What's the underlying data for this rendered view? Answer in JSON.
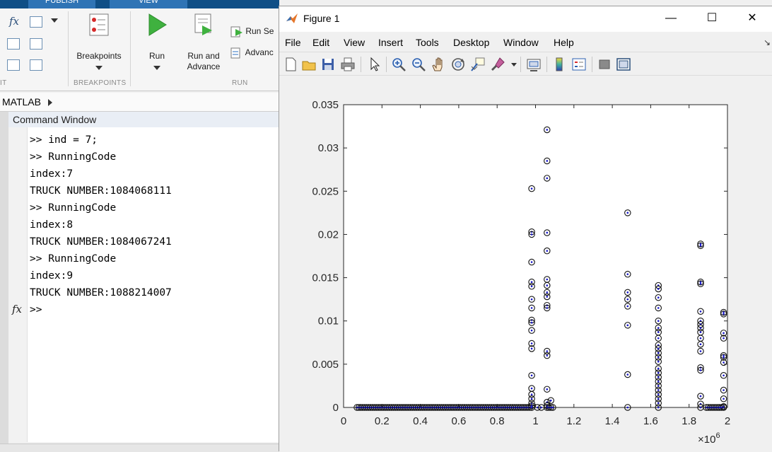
{
  "toolstrip": {
    "tabs": [
      "PUBLISH",
      "VIEW"
    ],
    "breakpoints_label": "Breakpoints",
    "run_label": "Run",
    "run_and_advance_label": "Run and\nAdvance",
    "run_section_label": "Run Se",
    "advance_label": "Advanc",
    "section_breakpoints": "BREAKPOINTS",
    "section_run": "RUN",
    "section_left": "IT"
  },
  "address_bar": {
    "path": "MATLAB"
  },
  "command_window": {
    "title": "Command Window",
    "lines": [
      ">> ind = 7;",
      ">> RunningCode",
      "index:7",
      "TRUCK NUMBER:1084068111",
      ">> RunningCode",
      "index:8",
      "TRUCK NUMBER:1084067241",
      ">> RunningCode",
      "index:9",
      "TRUCK NUMBER:1088214007"
    ],
    "prompt": ">>",
    "fx_symbol": "fx"
  },
  "figure": {
    "title": "Figure 1",
    "window_controls": {
      "minimize": "—",
      "maximize": "☐",
      "close": "✕"
    },
    "menus": [
      "File",
      "Edit",
      "View",
      "Insert",
      "Tools",
      "Desktop",
      "Window",
      "Help"
    ],
    "toolbar_icons": [
      "new-figure-icon",
      "open-file-icon",
      "save-icon",
      "print-icon",
      "select-arrow-icon",
      "zoom-in-icon",
      "zoom-out-icon",
      "pan-hand-icon",
      "rotate-3d-icon",
      "data-cursor-icon",
      "brush-icon",
      "link-plot-icon",
      "colorbar-icon",
      "legend-icon",
      "hide-plot-tools-icon",
      "show-plot-tools-icon"
    ],
    "accent_marker_color": "#1515c8"
  },
  "chart_data": {
    "type": "scatter",
    "title": "",
    "xlabel": "",
    "ylabel": "",
    "x_exponent_label": "×10",
    "x_exponent_power": "6",
    "xlim": [
      0,
      2
    ],
    "ylim": [
      0,
      0.035
    ],
    "x_ticks": [
      "0",
      "0.2",
      "0.4",
      "0.6",
      "0.8",
      "1",
      "1.2",
      "1.4",
      "1.6",
      "1.8",
      "2"
    ],
    "y_ticks": [
      "0",
      "0.005",
      "0.01",
      "0.015",
      "0.02",
      "0.025",
      "0.03",
      "0.035"
    ],
    "grid": false,
    "marker": "circle-dot",
    "points": [
      [
        0.07,
        0
      ],
      [
        0.08,
        0
      ],
      [
        0.09,
        0
      ],
      [
        0.1,
        0
      ],
      [
        0.11,
        0
      ],
      [
        0.12,
        0
      ],
      [
        0.13,
        0
      ],
      [
        0.14,
        0
      ],
      [
        0.15,
        0
      ],
      [
        0.16,
        0
      ],
      [
        0.17,
        0
      ],
      [
        0.18,
        0
      ],
      [
        0.19,
        0
      ],
      [
        0.2,
        0
      ],
      [
        0.21,
        0
      ],
      [
        0.22,
        0
      ],
      [
        0.23,
        0
      ],
      [
        0.24,
        0
      ],
      [
        0.25,
        0
      ],
      [
        0.26,
        0
      ],
      [
        0.27,
        0
      ],
      [
        0.28,
        0
      ],
      [
        0.29,
        0
      ],
      [
        0.3,
        0
      ],
      [
        0.31,
        0
      ],
      [
        0.32,
        0
      ],
      [
        0.33,
        0
      ],
      [
        0.34,
        0
      ],
      [
        0.35,
        0
      ],
      [
        0.36,
        0
      ],
      [
        0.37,
        0
      ],
      [
        0.38,
        0
      ],
      [
        0.39,
        0
      ],
      [
        0.4,
        0
      ],
      [
        0.41,
        0
      ],
      [
        0.42,
        0
      ],
      [
        0.43,
        0
      ],
      [
        0.44,
        0
      ],
      [
        0.45,
        0
      ],
      [
        0.46,
        0
      ],
      [
        0.47,
        0
      ],
      [
        0.48,
        0
      ],
      [
        0.49,
        0
      ],
      [
        0.5,
        0
      ],
      [
        0.51,
        0
      ],
      [
        0.52,
        0
      ],
      [
        0.53,
        0
      ],
      [
        0.54,
        0
      ],
      [
        0.55,
        0
      ],
      [
        0.56,
        0
      ],
      [
        0.57,
        0
      ],
      [
        0.58,
        0
      ],
      [
        0.59,
        0
      ],
      [
        0.6,
        0
      ],
      [
        0.61,
        0
      ],
      [
        0.62,
        0
      ],
      [
        0.63,
        0
      ],
      [
        0.64,
        0
      ],
      [
        0.65,
        0
      ],
      [
        0.66,
        0
      ],
      [
        0.67,
        0
      ],
      [
        0.68,
        0
      ],
      [
        0.69,
        0
      ],
      [
        0.7,
        0
      ],
      [
        0.71,
        0
      ],
      [
        0.72,
        0
      ],
      [
        0.73,
        0
      ],
      [
        0.74,
        0
      ],
      [
        0.75,
        0
      ],
      [
        0.76,
        0
      ],
      [
        0.77,
        0
      ],
      [
        0.78,
        0
      ],
      [
        0.79,
        0
      ],
      [
        0.8,
        0
      ],
      [
        0.81,
        0
      ],
      [
        0.82,
        0
      ],
      [
        0.83,
        0
      ],
      [
        0.84,
        0
      ],
      [
        0.85,
        0
      ],
      [
        0.86,
        0
      ],
      [
        0.87,
        0
      ],
      [
        0.88,
        0
      ],
      [
        0.89,
        0
      ],
      [
        0.9,
        0
      ],
      [
        0.91,
        0
      ],
      [
        0.92,
        0
      ],
      [
        0.93,
        0
      ],
      [
        0.94,
        0
      ],
      [
        0.95,
        0
      ],
      [
        0.96,
        0
      ],
      [
        0.97,
        0
      ],
      [
        0.98,
        0.0253
      ],
      [
        0.98,
        0.0203
      ],
      [
        0.98,
        0.02
      ],
      [
        0.98,
        0.0168
      ],
      [
        0.98,
        0.0145
      ],
      [
        0.98,
        0.014
      ],
      [
        0.98,
        0.0125
      ],
      [
        0.98,
        0.0115
      ],
      [
        0.98,
        0.0101
      ],
      [
        0.98,
        0.0098
      ],
      [
        0.98,
        0.0089
      ],
      [
        0.98,
        0.0074
      ],
      [
        0.98,
        0.0068
      ],
      [
        0.98,
        0.0037
      ],
      [
        0.98,
        0.0022
      ],
      [
        0.98,
        0.0015
      ],
      [
        0.98,
        0.001
      ],
      [
        0.98,
        0.0005
      ],
      [
        0.98,
        0.0002
      ],
      [
        0.98,
        0
      ],
      [
        1.06,
        0.0321
      ],
      [
        1.06,
        0.0285
      ],
      [
        1.06,
        0.0265
      ],
      [
        1.06,
        0.0202
      ],
      [
        1.06,
        0.0181
      ],
      [
        1.06,
        0.0148
      ],
      [
        1.06,
        0.0141
      ],
      [
        1.06,
        0.0133
      ],
      [
        1.06,
        0.0128
      ],
      [
        1.06,
        0.0118
      ],
      [
        1.06,
        0.0115
      ],
      [
        1.06,
        0.0065
      ],
      [
        1.06,
        0.006
      ],
      [
        1.06,
        0.0021
      ],
      [
        1.06,
        0.0006
      ],
      [
        1.06,
        0.0002
      ],
      [
        1.06,
        0
      ],
      [
        1.01,
        0
      ],
      [
        1.03,
        0
      ],
      [
        1.07,
        0
      ],
      [
        1.08,
        0
      ],
      [
        1.08,
        0.0008
      ],
      [
        1.09,
        0
      ],
      [
        1.48,
        0.0225
      ],
      [
        1.48,
        0.0154
      ],
      [
        1.48,
        0.0133
      ],
      [
        1.48,
        0.0125
      ],
      [
        1.48,
        0.0117
      ],
      [
        1.48,
        0.0095
      ],
      [
        1.48,
        0.0038
      ],
      [
        1.48,
        0
      ],
      [
        1.64,
        0.0141
      ],
      [
        1.64,
        0.0137
      ],
      [
        1.64,
        0.0127
      ],
      [
        1.64,
        0.0115
      ],
      [
        1.64,
        0.01
      ],
      [
        1.64,
        0.0092
      ],
      [
        1.64,
        0.0087
      ],
      [
        1.64,
        0.008
      ],
      [
        1.64,
        0.0072
      ],
      [
        1.64,
        0.0068
      ],
      [
        1.64,
        0.0063
      ],
      [
        1.64,
        0.0058
      ],
      [
        1.64,
        0.0053
      ],
      [
        1.64,
        0.0045
      ],
      [
        1.64,
        0.004
      ],
      [
        1.64,
        0.0035
      ],
      [
        1.64,
        0.003
      ],
      [
        1.64,
        0.0025
      ],
      [
        1.64,
        0.002
      ],
      [
        1.64,
        0.0015
      ],
      [
        1.64,
        0.001
      ],
      [
        1.64,
        0.0005
      ],
      [
        1.64,
        0
      ],
      [
        1.86,
        0.0189
      ],
      [
        1.86,
        0.0187
      ],
      [
        1.86,
        0.0145
      ],
      [
        1.86,
        0.0143
      ],
      [
        1.86,
        0.0111
      ],
      [
        1.86,
        0.01
      ],
      [
        1.86,
        0.0096
      ],
      [
        1.86,
        0.0092
      ],
      [
        1.86,
        0.0087
      ],
      [
        1.86,
        0.008
      ],
      [
        1.86,
        0.0073
      ],
      [
        1.86,
        0.0065
      ],
      [
        1.86,
        0.0046
      ],
      [
        1.86,
        0.0043
      ],
      [
        1.86,
        0.0013
      ],
      [
        1.86,
        0.0004
      ],
      [
        1.86,
        0
      ],
      [
        1.89,
        0
      ],
      [
        1.9,
        0
      ],
      [
        1.91,
        0
      ],
      [
        1.92,
        0
      ],
      [
        1.93,
        0
      ],
      [
        1.94,
        0
      ],
      [
        1.95,
        0
      ],
      [
        1.98,
        0.011
      ],
      [
        1.98,
        0.0108
      ],
      [
        1.98,
        0.0086
      ],
      [
        1.98,
        0.008
      ],
      [
        1.98,
        0.006
      ],
      [
        1.98,
        0.0058
      ],
      [
        1.98,
        0.0052
      ],
      [
        1.98,
        0.0037
      ],
      [
        1.98,
        0.002
      ],
      [
        1.98,
        0.001
      ],
      [
        1.98,
        0.0001
      ],
      [
        1.98,
        0
      ],
      [
        1.97,
        0
      ],
      [
        1.96,
        0
      ]
    ]
  }
}
